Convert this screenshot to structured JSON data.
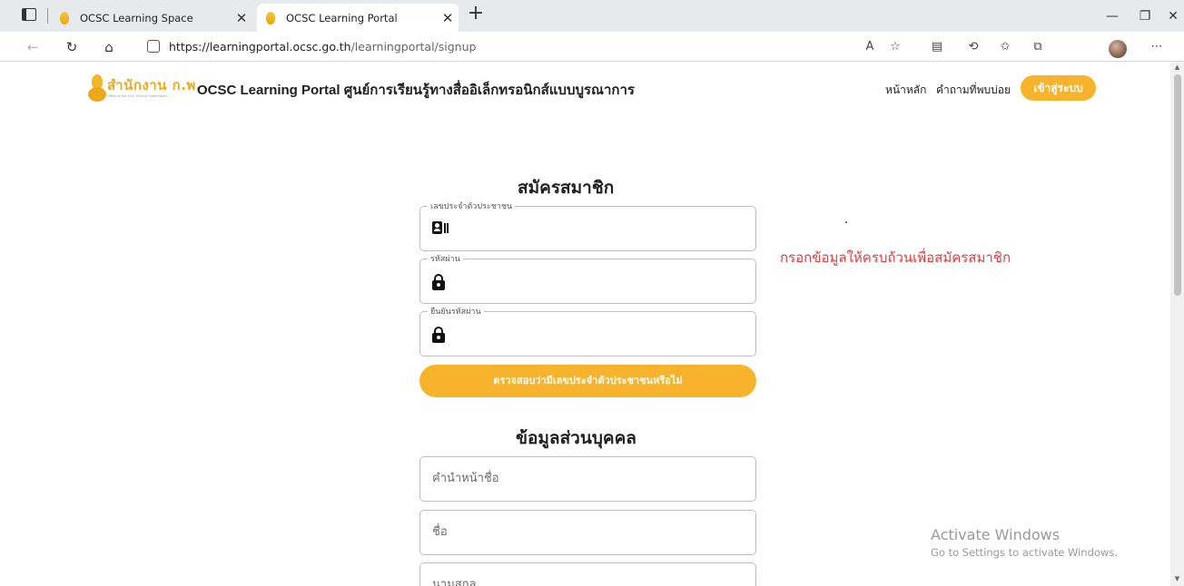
{
  "browser": {
    "tabs": [
      {
        "title": "OCSC Learning Space",
        "close": "✕"
      },
      {
        "title": "OCSC Learning Portal",
        "close": "✕"
      }
    ],
    "new_tab": "+",
    "url_scheme_host": "https://learningportal.ocsc.go.th",
    "url_path": "/learningportal/signup"
  },
  "site": {
    "logo_text": "สำนักงาน ก.พ.",
    "logo_subtext": "Office of the Civil Service Commission",
    "title": "OCSC Learning Portal ศูนย์การเรียนรู้ทางสื่ออิเล็กทรอนิกส์แบบบูรณาการ",
    "nav": {
      "home": "หน้าหลัก",
      "faq": "คำถามที่พบบ่อย",
      "login": "เข้าสู่ระบบ"
    }
  },
  "signup": {
    "heading": "สมัครสมาชิก",
    "fields": {
      "citizen_id_label": "เลขประจำตัวประชาชน",
      "password_label": "รหัสผ่าน",
      "confirm_password_label": "ยืนยันรหัสผ่าน"
    },
    "check_button": "ตรวจสอบว่ามีเลขประจำตัวประชาชนหรือไม่",
    "note": "กรอกข้อมูลให้ครบถ้วนเพื่อสมัครสมาชิก"
  },
  "personal": {
    "heading": "ข้อมูลส่วนบุคคล",
    "title_prefix_placeholder": "คำนำหน้าชื่อ",
    "first_name_placeholder": "ชื่อ",
    "last_name_placeholder": "นามสกุล"
  },
  "watermark": {
    "title": "Activate Windows",
    "subtitle": "Go to Settings to activate Windows."
  },
  "icons": [
    "tab-actions-icon",
    "back-icon",
    "refresh-icon",
    "home-icon",
    "lock-icon",
    "read-aloud-icon",
    "favorite-add-icon",
    "reading-view-icon",
    "extensions-icon",
    "favorites-icon",
    "collections-icon",
    "profile-avatar-icon",
    "more-icon",
    "id-card-icon",
    "padlock-icon"
  ]
}
